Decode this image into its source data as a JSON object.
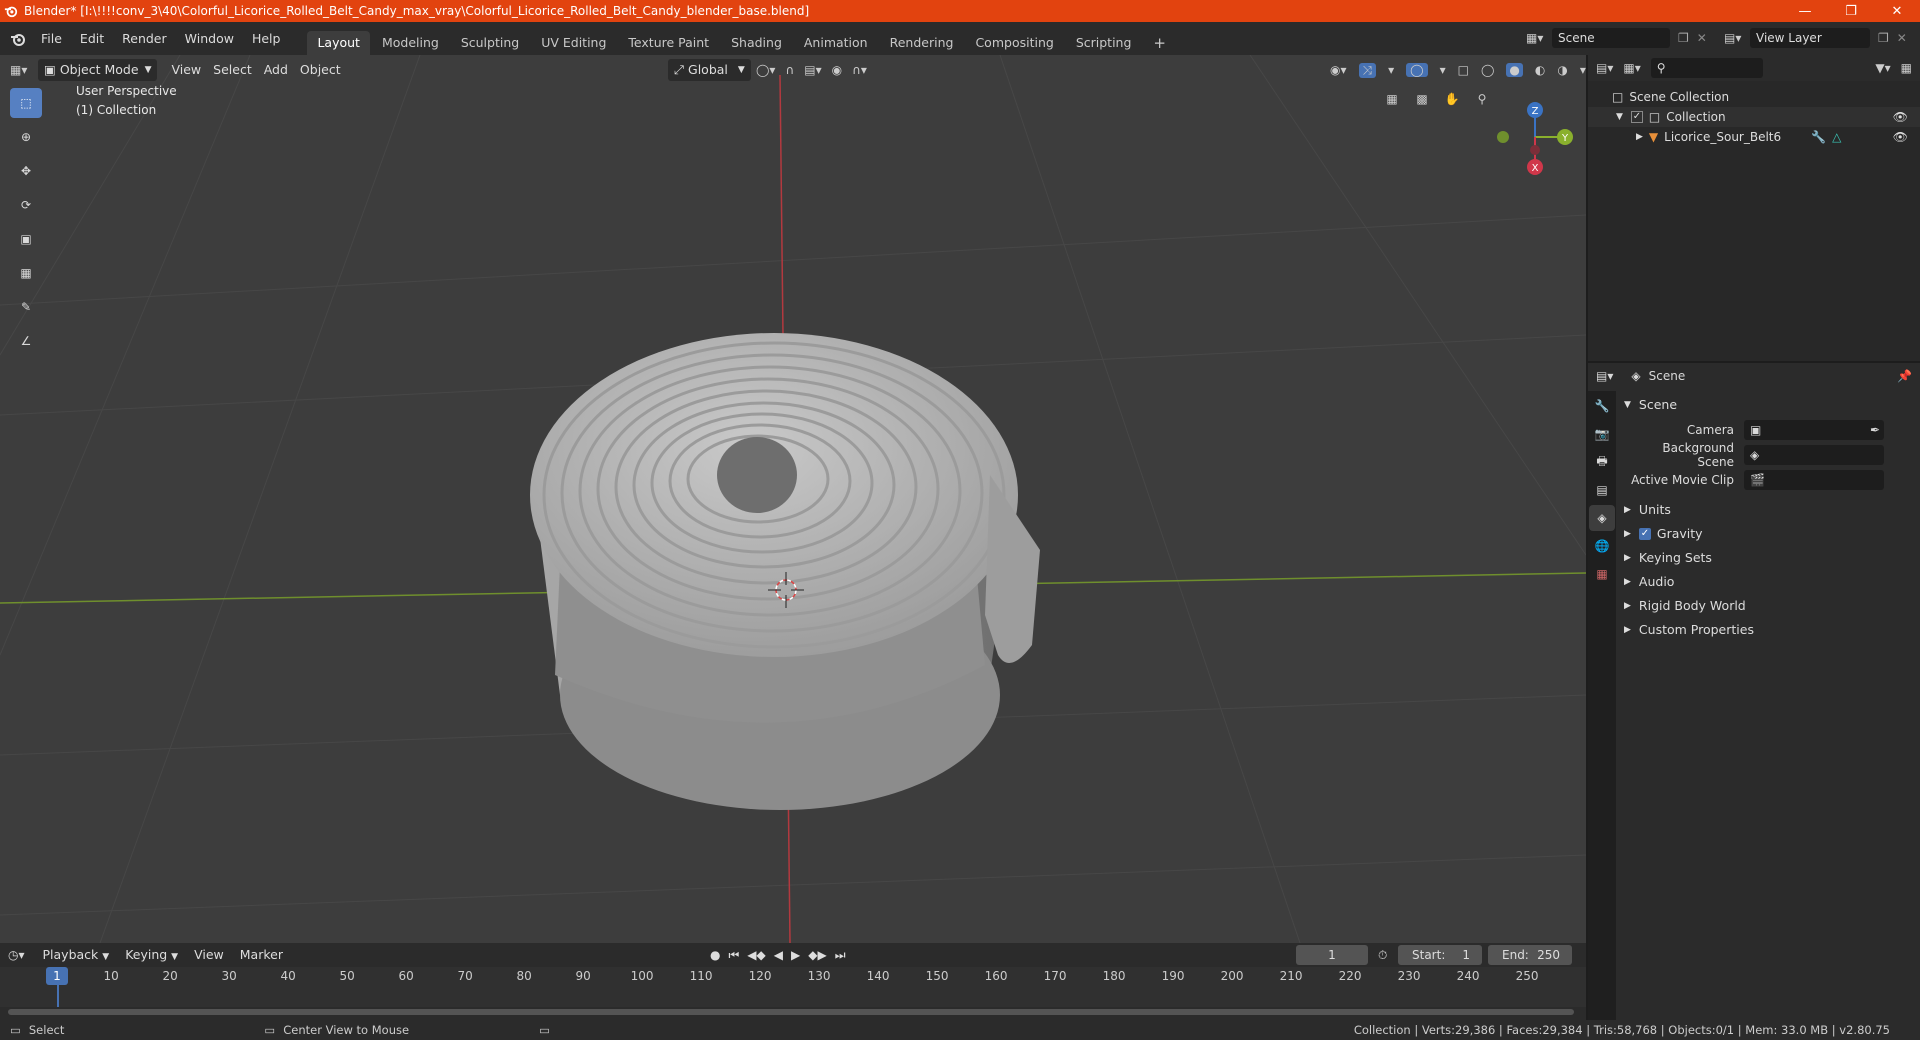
{
  "window": {
    "title": "Blender* [I:\\!!!!conv_3\\40\\Colorful_Licorice_Rolled_Belt_Candy_max_vray\\Colorful_Licorice_Rolled_Belt_Candy_blender_base.blend]",
    "accent": "#e2430f"
  },
  "menu": {
    "items": [
      "File",
      "Edit",
      "Render",
      "Window",
      "Help"
    ]
  },
  "workspaces": [
    "Layout",
    "Modeling",
    "Sculpting",
    "UV Editing",
    "Texture Paint",
    "Shading",
    "Animation",
    "Rendering",
    "Compositing",
    "Scripting"
  ],
  "scene_selector": {
    "value": "Scene"
  },
  "view_layer_selector": {
    "value": "View Layer"
  },
  "viewport_header": {
    "mode": "Object Mode",
    "menus": [
      "View",
      "Select",
      "Add",
      "Object"
    ],
    "transform_orientation": "Global"
  },
  "viewport": {
    "perspective_label": "User Perspective",
    "collection_label": "(1) Collection",
    "gizmo": {
      "z": "Z",
      "y": "Y",
      "x": "X"
    }
  },
  "outliner": {
    "root": "Scene Collection",
    "collection": "Collection",
    "object": "Licorice_Sour_Belt6"
  },
  "properties": {
    "header": "Scene",
    "panel_title": "Scene",
    "fields": [
      {
        "label": "Camera"
      },
      {
        "label": "Background Scene"
      },
      {
        "label": "Active Movie Clip"
      }
    ],
    "panels": [
      "Units",
      "Gravity",
      "Keying Sets",
      "Audio",
      "Rigid Body World",
      "Custom Properties"
    ]
  },
  "timeline": {
    "menus": [
      "Playback",
      "Keying",
      "View",
      "Marker"
    ],
    "current_frame": "1",
    "start_label": "Start:",
    "start": "1",
    "end_label": "End:",
    "end": "250",
    "ticks": [
      "10",
      "20",
      "30",
      "40",
      "50",
      "60",
      "70",
      "80",
      "90",
      "100",
      "110",
      "120",
      "130",
      "140",
      "150",
      "160",
      "170",
      "180",
      "190",
      "200",
      "210",
      "220",
      "230",
      "240",
      "250"
    ],
    "marker": "1"
  },
  "statusbar": {
    "select": "Select",
    "center_view": "Center View to Mouse",
    "stats": "Collection | Verts:29,386 | Faces:29,384 | Tris:58,768 | Objects:0/1 | Mem: 33.0 MB | v2.80.75"
  }
}
